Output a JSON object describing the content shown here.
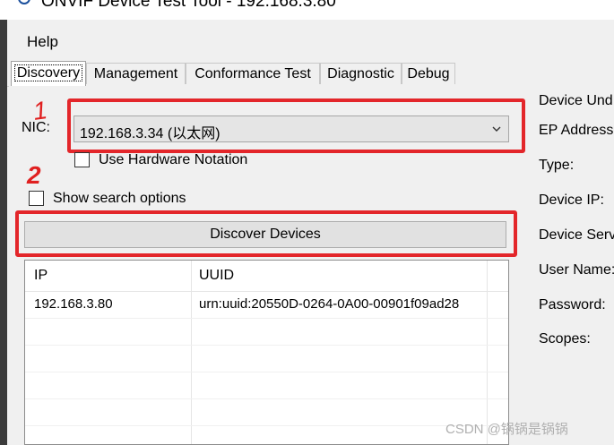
{
  "window": {
    "title": "ONVIF Device Test Tool - 192.168.3.80"
  },
  "menu": {
    "help": "Help"
  },
  "tabs": [
    "Discovery",
    "Management",
    "Conformance Test",
    "Diagnostic",
    "Debug"
  ],
  "annotations": {
    "one": "1",
    "two": "2"
  },
  "discovery": {
    "nic_label": "NIC:",
    "nic_value": "192.168.3.34 (以太网)",
    "use_hw_notation_label": "Use Hardware Notation",
    "use_hw_notation_checked": false,
    "show_search_options_label": "Show search options",
    "show_search_options_checked": false,
    "discover_button": "Discover Devices",
    "table": {
      "columns": [
        "IP",
        "UUID"
      ],
      "rows": [
        {
          "ip": "192.168.3.80",
          "uuid": "urn:uuid:20550D-0264-0A00-00901f09ad28"
        }
      ]
    }
  },
  "device_panel": {
    "labels": [
      "Device Und",
      "EP Address:",
      "Type:",
      "Device IP:",
      "Device Serv",
      "User Name:",
      "Password:",
      "Scopes:"
    ]
  },
  "watermark": "CSDN @锅锅是锅锅",
  "colors": {
    "highlight_box": "#e3262a",
    "annotation_text": "#e02020"
  }
}
